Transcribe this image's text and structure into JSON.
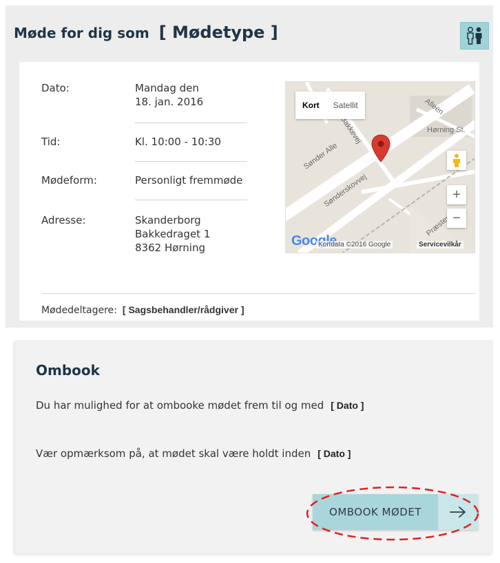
{
  "header": {
    "title_prefix": "Møde for dig som",
    "meeting_type": "[ Mødetype ]",
    "person_icon": "person-icon"
  },
  "details": {
    "date_label": "Dato:",
    "date_line1": "Mandag den",
    "date_line2": "18. jan. 2016",
    "time_label": "Tid:",
    "time_value": "Kl. 10:00 - 10:30",
    "form_label": "Mødeform:",
    "form_value": "Personligt fremmøde",
    "address_label": "Adresse:",
    "address_line1": "Skanderborg",
    "address_line2": "Bakkedraget 1",
    "address_line3": "8362 Hørning"
  },
  "map": {
    "tab_map": "Kort",
    "tab_satellite": "Satellit",
    "streets": [
      "Alleen",
      "Hørning St.",
      "Sønder Alle",
      "Sønderskovvej",
      "Bakkevej",
      "Præstevej"
    ],
    "zoom_in": "+",
    "zoom_out": "−",
    "logo": "Google",
    "attribution": "Kortdata ©2016 Google",
    "terms": "Servicevilkår",
    "marker_color": "#d93a2f"
  },
  "participants": {
    "label": "Mødedeltagere:",
    "value": "[ Sagsbehandler/rådgiver ]"
  },
  "rebook": {
    "title": "Ombook",
    "deadline_text": "Du har mulighed for at ombooke mødet frem til og med",
    "deadline_value": "[ Dato ]",
    "held_text": "Vær opmærksom på, at mødet skal være holdt inden",
    "held_value": "[ Dato ]",
    "button_label": "OMBOOK MØDET",
    "button_icon": "arrow-right-icon"
  },
  "colors": {
    "accent": "#a9d6da",
    "highlight_ring": "#e0201f",
    "title_text": "#1f3447"
  }
}
